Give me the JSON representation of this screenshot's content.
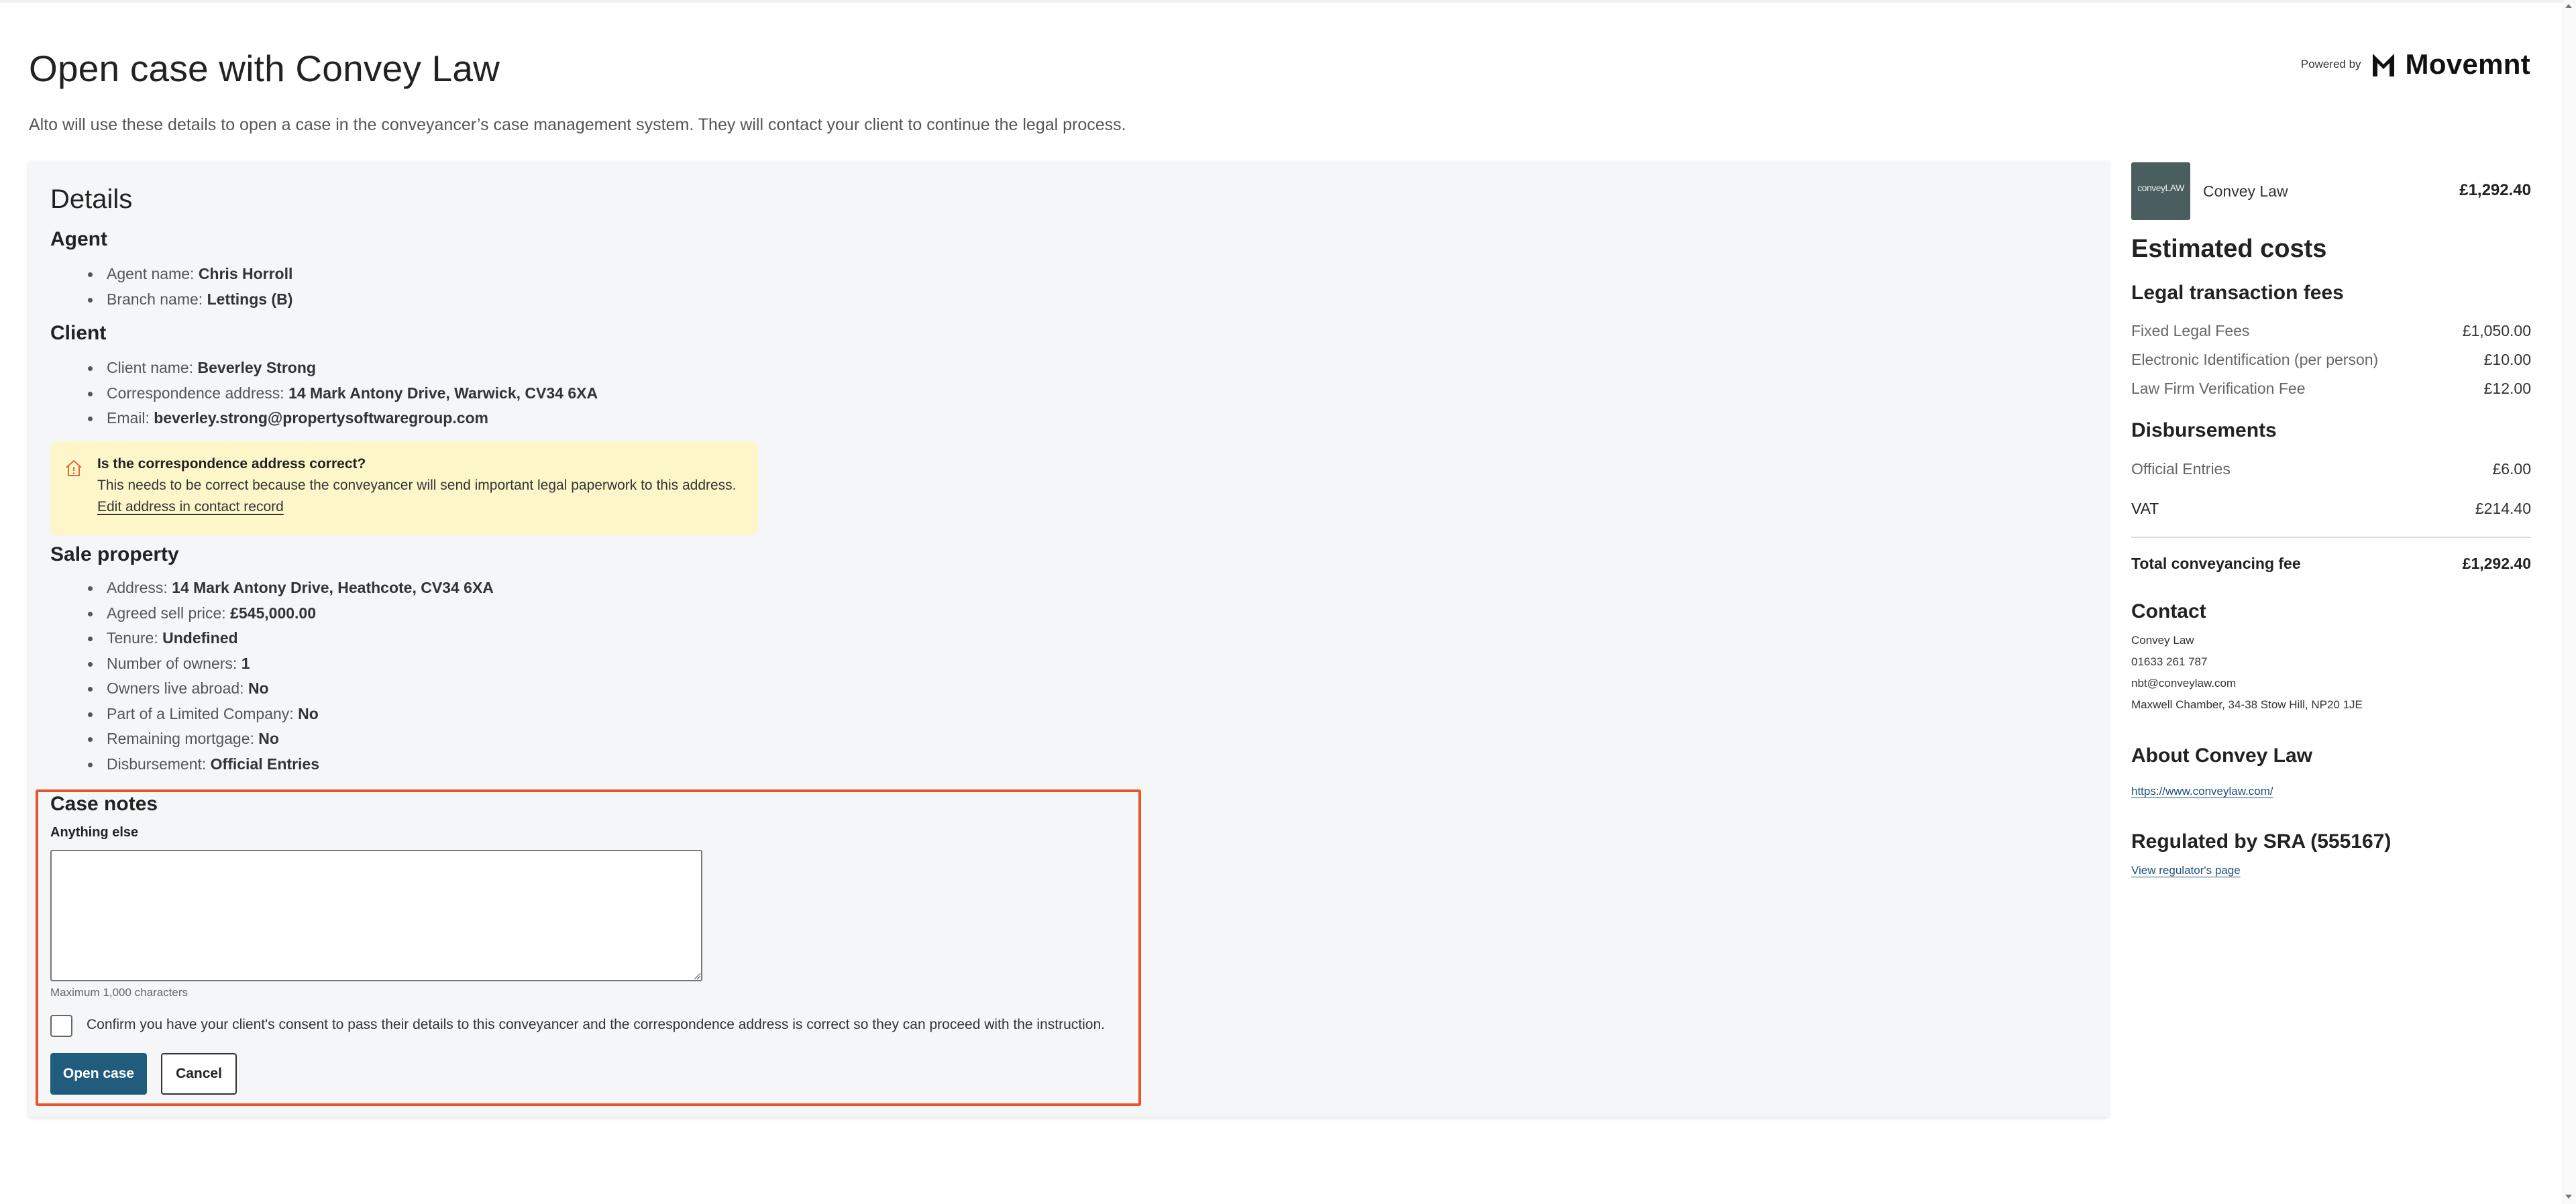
{
  "header": {
    "title": "Open case with Convey Law",
    "intro": "Alto will use these details to open a case in the conveyancer’s case management system. They will contact your client to continue the legal process.",
    "powered_by": "Powered by",
    "brand": "Movemnt",
    "brand_icon": "movemnt-logo-icon"
  },
  "details": {
    "heading": "Details",
    "agent": {
      "heading": "Agent",
      "items": [
        {
          "label": "Agent name: ",
          "value": "Chris Horroll"
        },
        {
          "label": "Branch name: ",
          "value": "Lettings (B)"
        }
      ]
    },
    "client": {
      "heading": "Client",
      "items": [
        {
          "label": "Client name: ",
          "value": "Beverley Strong"
        },
        {
          "label": "Correspondence address: ",
          "value": "14 Mark Antony Drive, Warwick, CV34 6XA"
        },
        {
          "label": "Email: ",
          "value": "beverley.strong@propertysoftwaregroup.com"
        }
      ]
    },
    "warning": {
      "icon": "house-warning-icon",
      "title": "Is the correspondence address correct?",
      "text": "This needs to be correct because the conveyancer will send important legal paperwork to this address.",
      "link": "Edit address in contact record",
      "color": "#fdf6c9"
    },
    "sale_property": {
      "heading": "Sale property",
      "items": [
        {
          "label": "Address: ",
          "value": "14 Mark Antony Drive, Heathcote, CV34 6XA"
        },
        {
          "label": "Agreed sell price: ",
          "value": "£545,000.00"
        },
        {
          "label": "Tenure: ",
          "value": "Undefined"
        },
        {
          "label": "Number of owners: ",
          "value": "1"
        },
        {
          "label": "Owners live abroad: ",
          "value": "No"
        },
        {
          "label": "Part of a Limited Company: ",
          "value": "No"
        },
        {
          "label": "Remaining mortgage: ",
          "value": "No"
        },
        {
          "label": "Disbursement: ",
          "value": "Official Entries"
        }
      ]
    }
  },
  "case_notes": {
    "heading": "Case notes",
    "field_label": "Anything else",
    "value": "",
    "hint": "Maximum 1,000 characters",
    "consent": "Confirm you have your client's consent to pass their details to this conveyancer and the correspondence address is correct so they can proceed with the instruction.",
    "consent_checked": false,
    "open_button": "Open case",
    "cancel_button": "Cancel",
    "highlight_color": "#e8552a",
    "primary_color": "#215c7d"
  },
  "sidebar": {
    "firm_logo_text": "conveyLAW",
    "firm_name": "Convey Law",
    "firm_total": "£1,292.40",
    "estimated_heading": "Estimated costs",
    "legal_heading": "Legal transaction fees",
    "legal_fees": [
      {
        "label": "Fixed Legal Fees",
        "amount": "£1,050.00"
      },
      {
        "label": "Electronic Identification (per person)",
        "amount": "£10.00"
      },
      {
        "label": "Law Firm Verification Fee",
        "amount": "£12.00"
      }
    ],
    "disbursements_heading": "Disbursements",
    "disbursements": [
      {
        "label": "Official Entries",
        "amount": "£6.00"
      }
    ],
    "vat": {
      "label": "VAT",
      "amount": "£214.40"
    },
    "total": {
      "label": "Total conveyancing fee",
      "amount": "£1,292.40"
    },
    "contact_heading": "Contact",
    "contact_lines": [
      "Convey Law",
      "01633 261 787",
      "nbt@conveylaw.com",
      "Maxwell Chamber, 34-38 Stow Hill, NP20 1JE"
    ],
    "about_heading": "About Convey Law",
    "about_link": "https://www.conveylaw.com/",
    "regulated_heading": "Regulated by SRA (555167)",
    "regulator_link": "View regulator's page"
  }
}
